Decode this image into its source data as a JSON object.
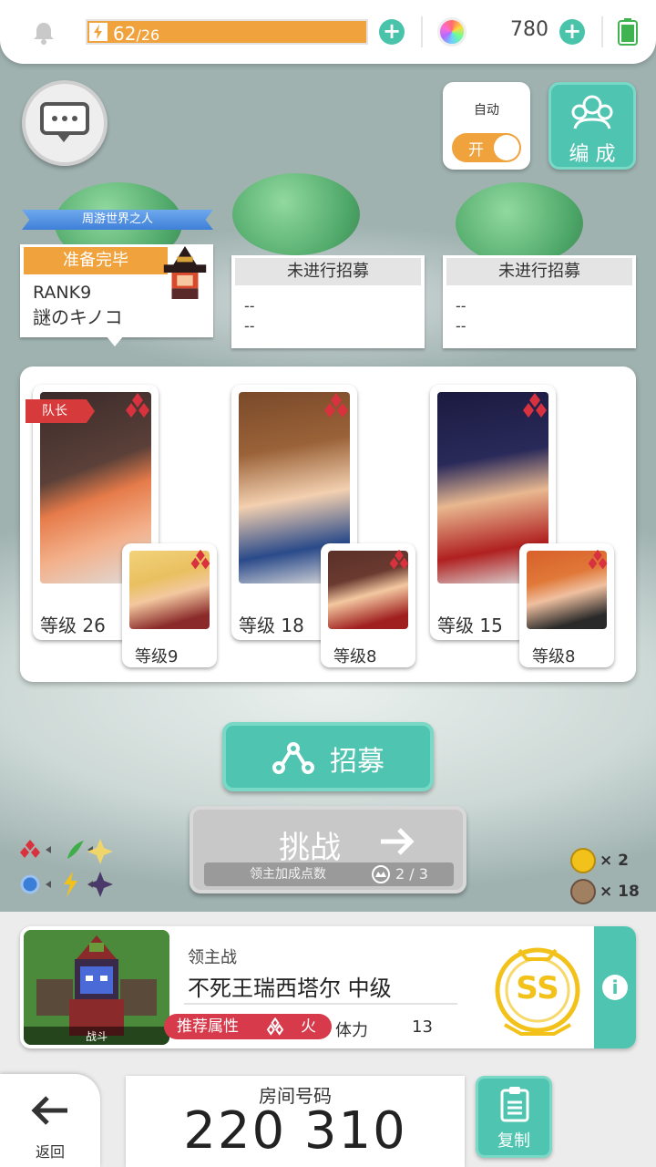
{
  "topbar": {
    "stamina_value": "62",
    "stamina_max": "/26",
    "stamina_fill": 1.0,
    "gems": "780"
  },
  "auto": {
    "label": "自动",
    "state": "开"
  },
  "formation": {
    "label": "编 成"
  },
  "recruit_slots": [
    {
      "banner": "周游世界之人",
      "status": "准备完毕",
      "rank": "RANK9",
      "name": "謎のキノコ"
    },
    {
      "status": "未进行招募",
      "line1": "--",
      "line2": "--"
    },
    {
      "status": "未进行招募",
      "line1": "--",
      "line2": "--"
    }
  ],
  "team": {
    "leader_tag": "队长",
    "units": [
      {
        "main_level": "等级 26",
        "sub_level": "等级9"
      },
      {
        "main_level": "等级 18",
        "sub_level": "等级8"
      },
      {
        "main_level": "等级 15",
        "sub_level": "等级8"
      }
    ]
  },
  "recruit_button": {
    "label": "招募"
  },
  "challenge": {
    "label": "挑战",
    "sub_label": "领主加成点数",
    "points": "2 / 3"
  },
  "items": [
    {
      "count": "× 2"
    },
    {
      "count": "× 18"
    }
  ],
  "boss": {
    "category": "领主战",
    "name": "不死王瑞西塔尔 中级",
    "pic_label": "战斗",
    "recommended": "推荐属性",
    "element": "火",
    "stamina_label": "体力",
    "stamina_cost": "13",
    "grade": "SS"
  },
  "room": {
    "label": "房间号码",
    "number": "220 310"
  },
  "back": {
    "label": "返回"
  },
  "copy": {
    "label": "复制"
  },
  "colors": {
    "accent": "#4fc4b0",
    "stamina": "#f0a23c",
    "fire": "#d63a4b",
    "gold": "#f3c21a"
  }
}
